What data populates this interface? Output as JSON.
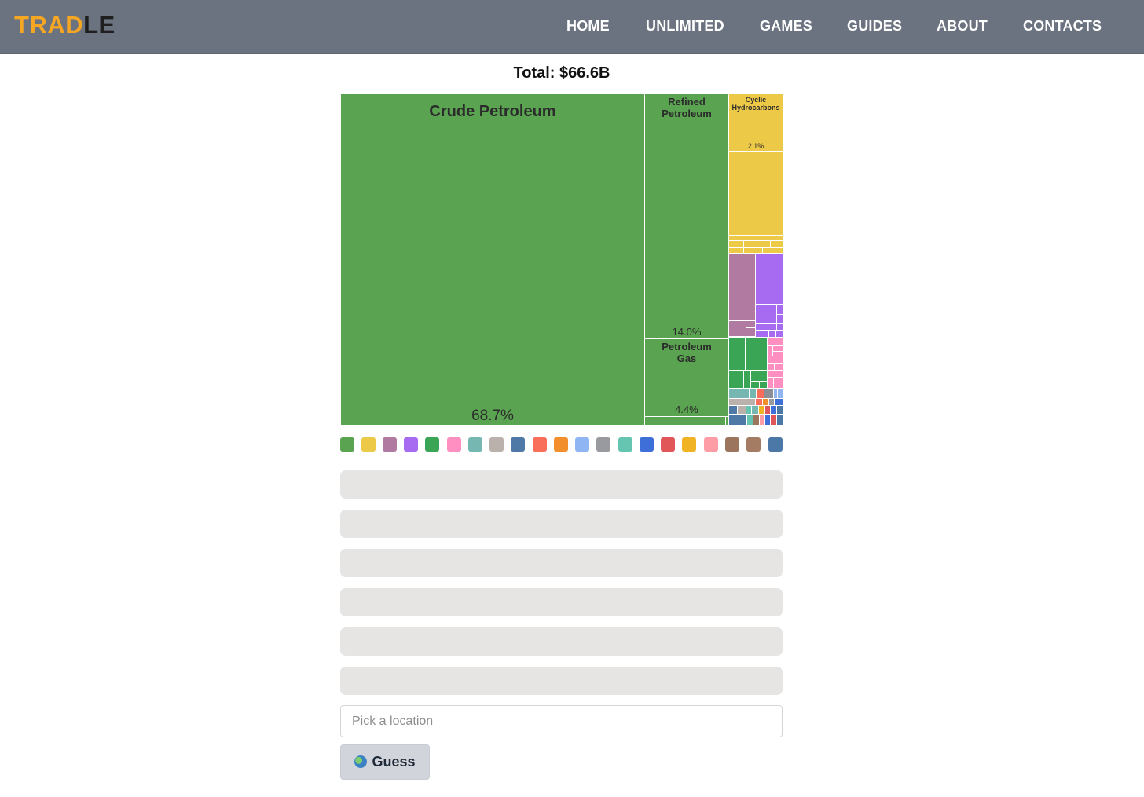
{
  "brand": {
    "logo_part1": "TRAD",
    "logo_part2": "LE"
  },
  "nav": [
    "HOME",
    "UNLIMITED",
    "GAMES",
    "GUIDES",
    "ABOUT",
    "CONTACTS"
  ],
  "total_label": "Total: $66.6B",
  "chart_data": {
    "type": "treemap",
    "total": "$66.6B",
    "items": [
      {
        "name": "Crude Petroleum",
        "share_pct": 68.7,
        "share_label": "68.7%",
        "color": "#5aa351"
      },
      {
        "name": "Refined Petroleum",
        "share_pct": 14.0,
        "share_label": "14.0%",
        "color": "#5aa351"
      },
      {
        "name": "Petroleum Gas",
        "share_pct": 4.4,
        "share_label": "4.4%",
        "color": "#5aa351"
      },
      {
        "name": "Cyclic Hydrocarbons",
        "share_pct": 2.1,
        "share_label": "2.1%",
        "color": "#edc948"
      }
    ]
  },
  "legend_colors": [
    "#5aa351",
    "#edc948",
    "#b07aa1",
    "#a66bf0",
    "#3aa655",
    "#ff8fc0",
    "#76b7b2",
    "#bab0ac",
    "#4e79a7",
    "#f96e5a",
    "#f28e2b",
    "#8fb6f2",
    "#999aa0",
    "#66c5b0",
    "#3e6fd8",
    "#e15759",
    "#f0b323",
    "#ff9da7",
    "#9c755f",
    "#a47c64",
    "#4c78a8"
  ],
  "guess_rows": [
    "",
    "",
    "",
    "",
    "",
    ""
  ],
  "location_input": {
    "placeholder": "Pick a location",
    "value": ""
  },
  "guess_button": {
    "label": "Guess",
    "icon": "globe-icon"
  }
}
